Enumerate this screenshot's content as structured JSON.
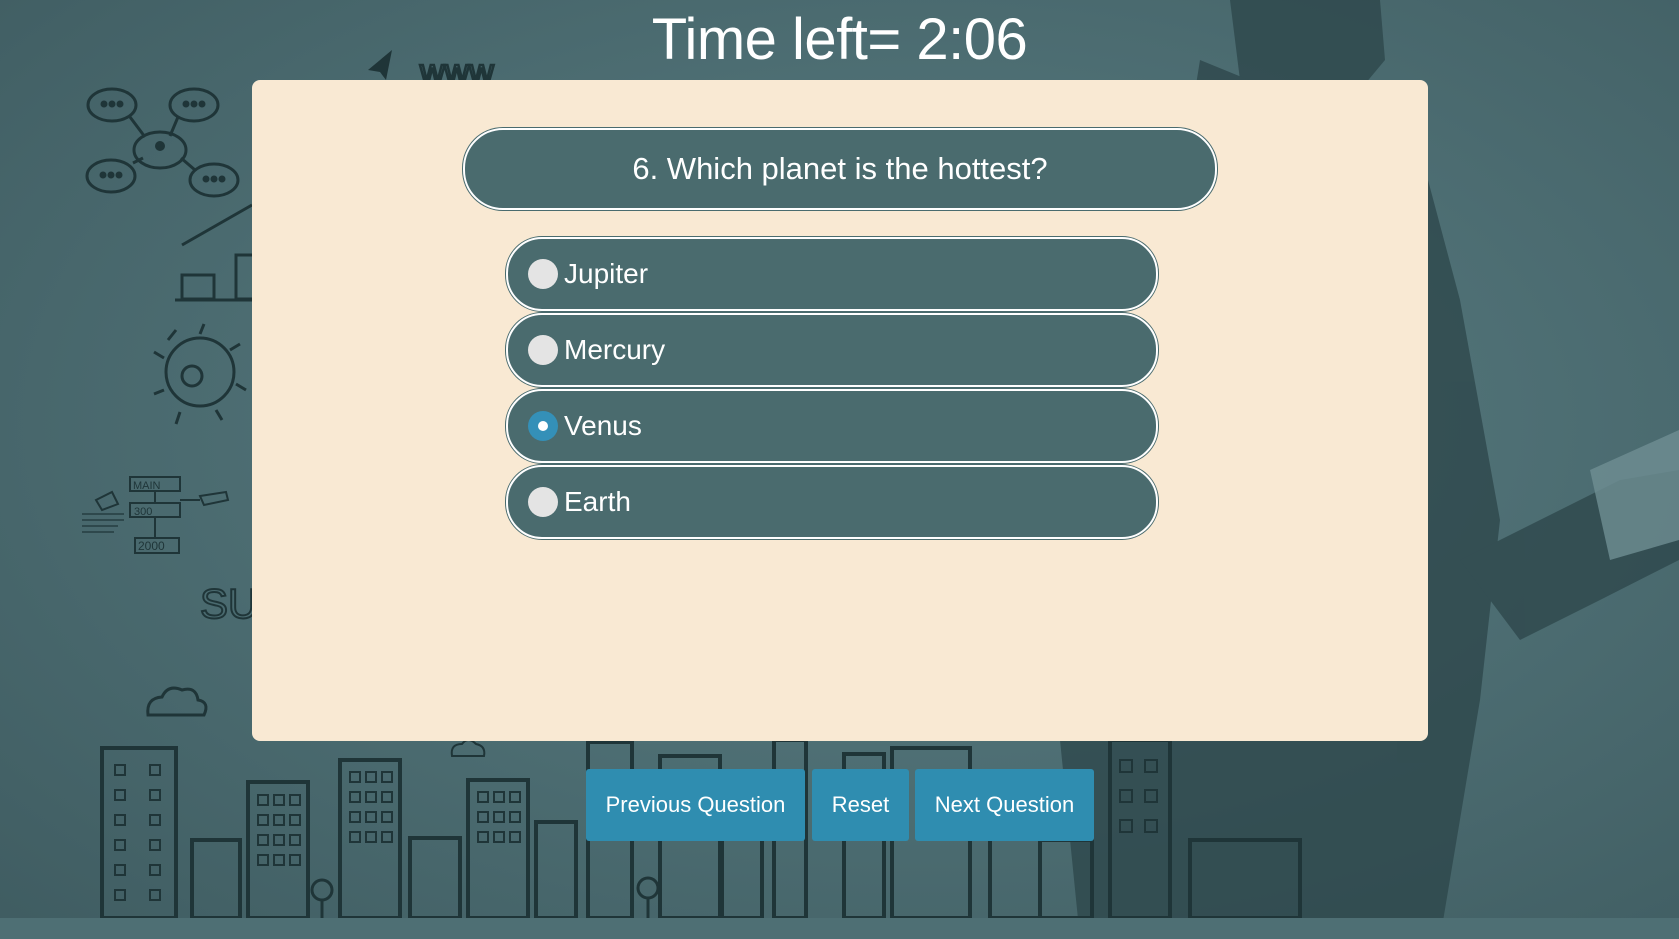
{
  "timer": {
    "text": "Time left= 2:06"
  },
  "question": {
    "text": "6. Which planet is the hottest?"
  },
  "options": [
    {
      "label": "Jupiter",
      "selected": false
    },
    {
      "label": "Mercury",
      "selected": false
    },
    {
      "label": "Venus",
      "selected": true
    },
    {
      "label": "Earth",
      "selected": false
    }
  ],
  "buttons": {
    "previous": "Previous Question",
    "reset": "Reset",
    "next": "Next Question"
  },
  "background": {
    "sketch_labels": [
      "www",
      "MAIN",
      "300",
      "2000",
      "SUC"
    ]
  },
  "colors": {
    "background": "#4e6f74",
    "card": "#f9e9d3",
    "pill": "#4a6b6e",
    "button": "#2f8db0",
    "radio_checked": "#3490b8"
  }
}
